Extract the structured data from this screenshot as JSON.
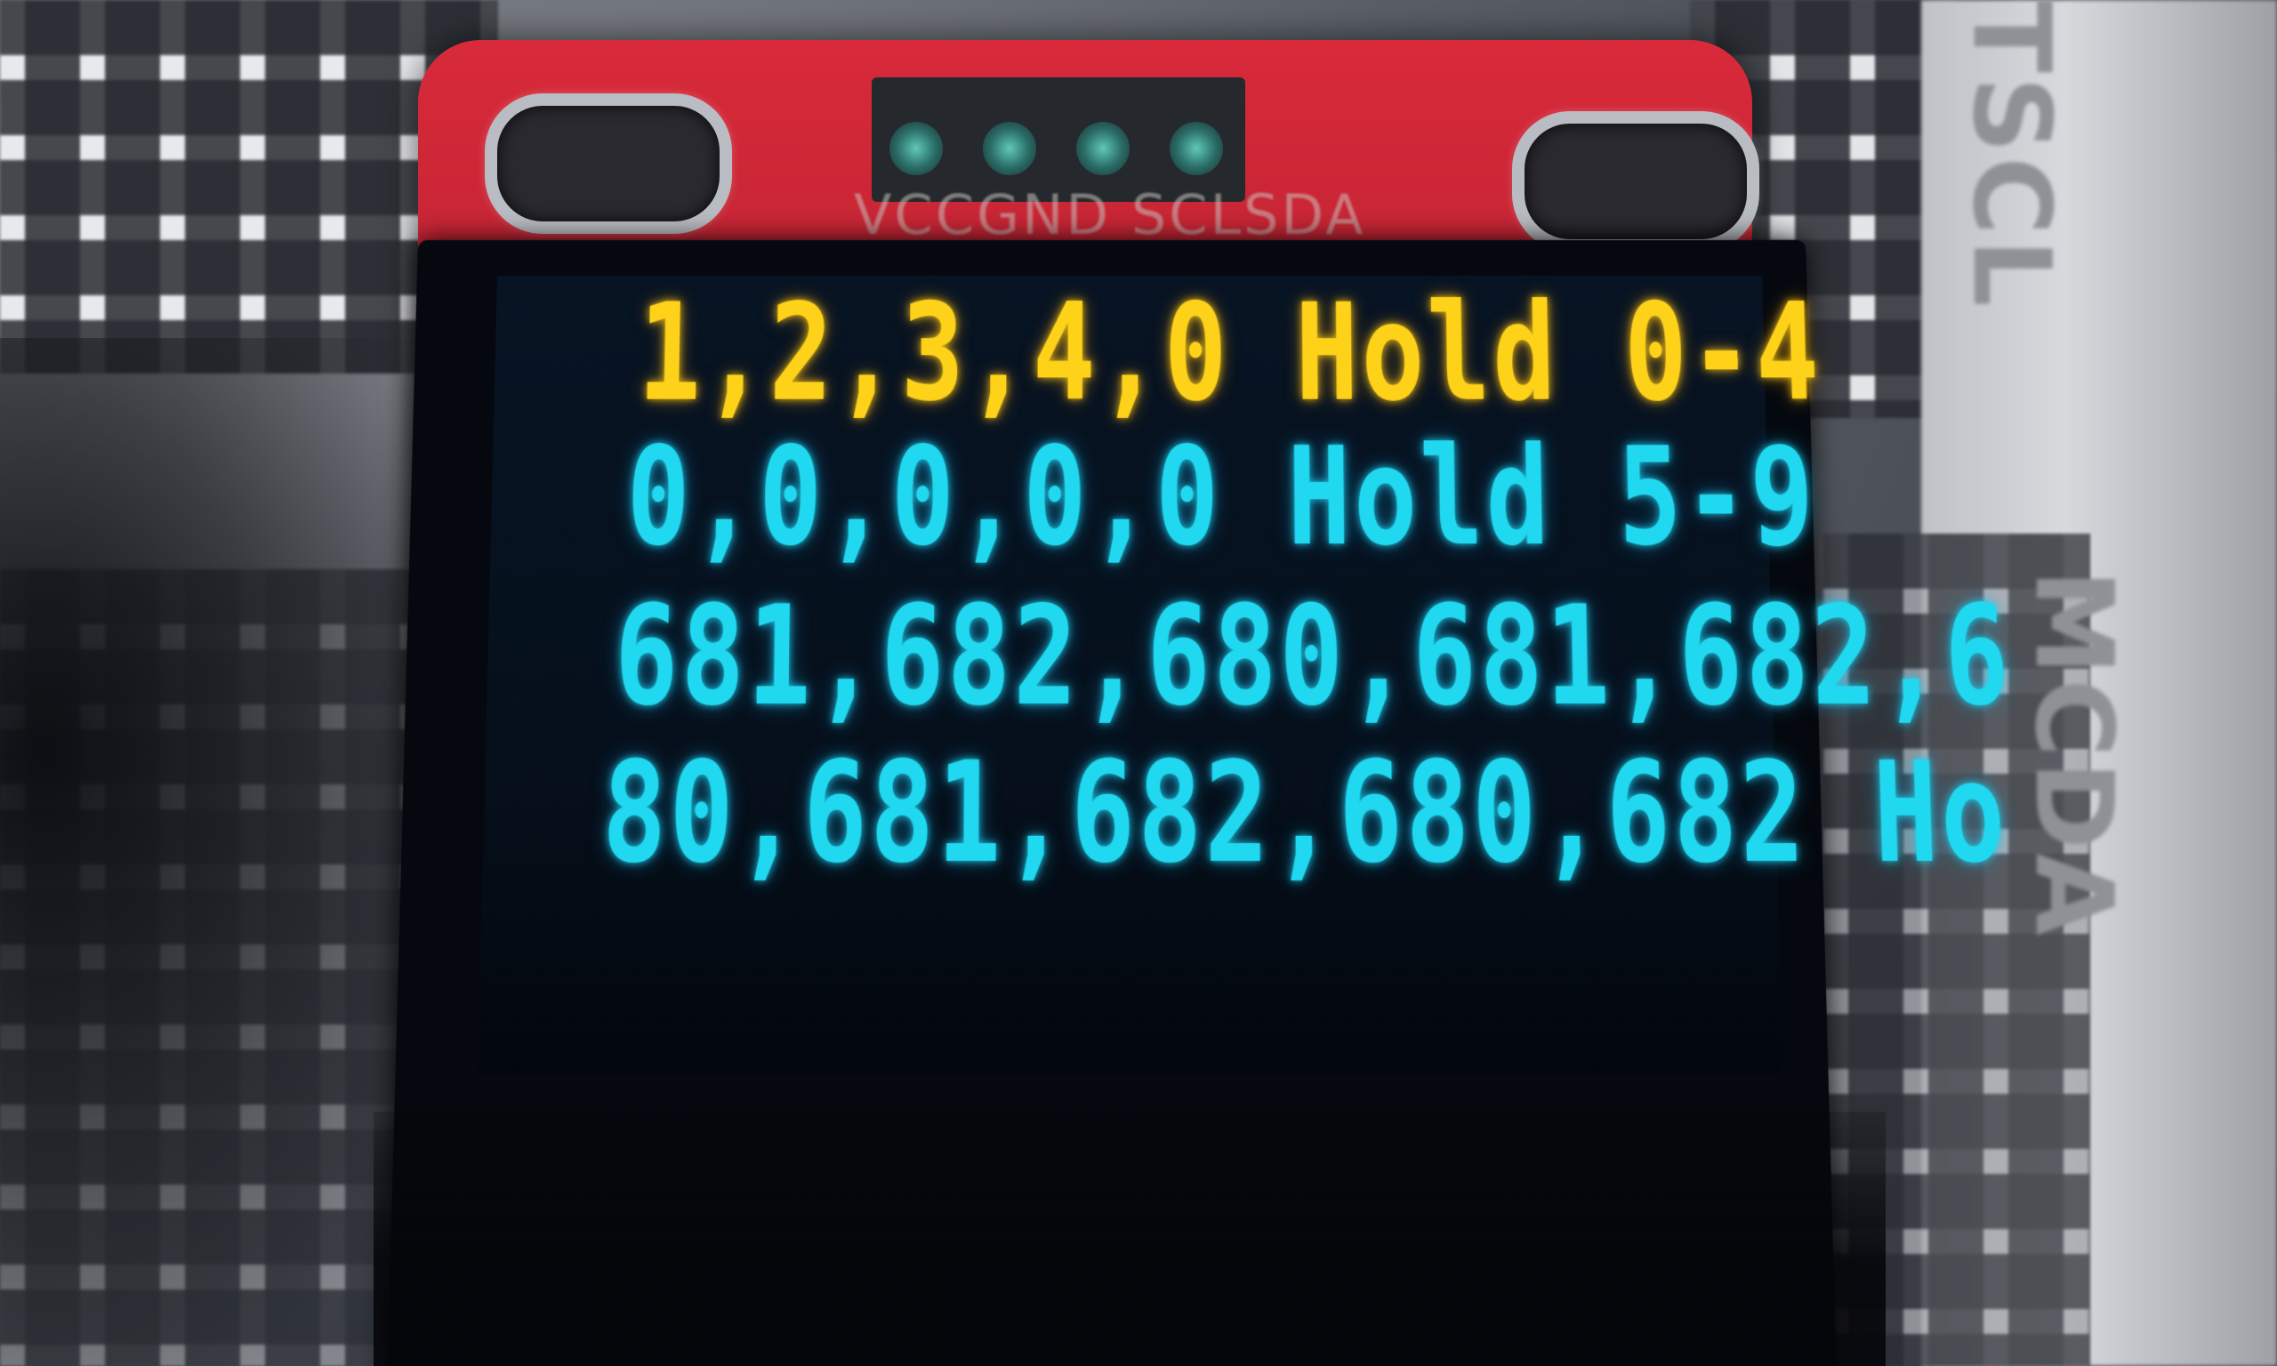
{
  "breadboard": {
    "rail_text_top": "TSCL",
    "rail_text_bottom": "MCDA"
  },
  "module": {
    "pin_labels": "VCCGND SCLSDA",
    "pins": [
      "VCC",
      "GND",
      "SCL",
      "SDA"
    ]
  },
  "oled": {
    "line_1": "1,2,3,4,0 Hold 0-4",
    "line_2": "0,0,0,0,0 Hold 5-9",
    "line_3": "681,682,680,681,682,6",
    "line_4": "80,681,682,680,682 Ho",
    "colors": {
      "yellow_band": "#ffd21a",
      "cyan_band": "#20d8f0",
      "pcb_red": "#c8202f"
    }
  }
}
